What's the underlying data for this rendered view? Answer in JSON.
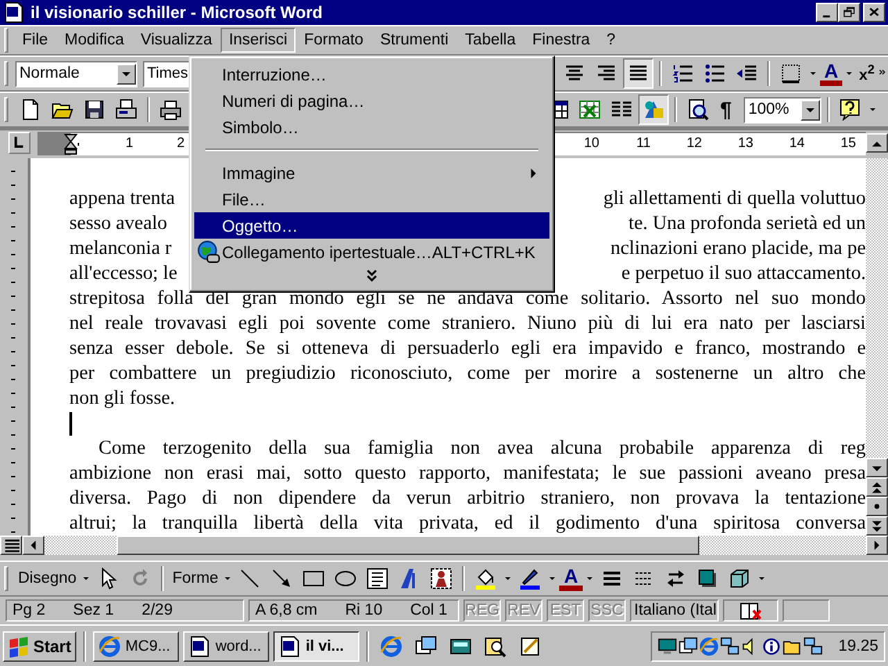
{
  "window": {
    "title": "il visionario schiller - Microsoft Word"
  },
  "menu_bar": [
    {
      "label": "File",
      "selected": false
    },
    {
      "label": "Modifica",
      "selected": false
    },
    {
      "label": "Visualizza",
      "selected": false
    },
    {
      "label": "Inserisci",
      "selected": true
    },
    {
      "label": "Formato",
      "selected": false
    },
    {
      "label": "Strumenti",
      "selected": false
    },
    {
      "label": "Tabella",
      "selected": false
    },
    {
      "label": "Finestra",
      "selected": false
    },
    {
      "label": "?",
      "selected": false
    }
  ],
  "formatting_toolbar": {
    "style": "Normale",
    "font": "Times",
    "alignment": [
      {
        "kind": "center",
        "selected": false
      },
      {
        "kind": "right",
        "selected": false
      },
      {
        "kind": "justify",
        "selected": true
      }
    ],
    "font_color": "A",
    "superscript": "x$^{2}$"
  },
  "standard_toolbar": {
    "drawing_toggle": {
      "on": true
    },
    "show_marks": "¶",
    "zoom": "100%"
  },
  "ruler": {
    "left_numbers": [
      "1",
      "2"
    ],
    "right_numbers": [
      "10",
      "11",
      "12",
      "13",
      "14",
      "15"
    ]
  },
  "insert_menu": [
    {
      "kind": "item",
      "label": "Interruzione…",
      "selected": false
    },
    {
      "kind": "item",
      "label": "Numeri di pagina…",
      "selected": false
    },
    {
      "kind": "item",
      "label": "Simbolo…",
      "selected": false
    },
    {
      "kind": "separator"
    },
    {
      "kind": "submenu",
      "label": "Immagine",
      "selected": false
    },
    {
      "kind": "item",
      "label": "File…",
      "selected": false
    },
    {
      "kind": "item",
      "label": "Oggetto…",
      "selected": true
    },
    {
      "kind": "link",
      "label": "Collegamento ipertestuale…",
      "shortcut": "ALT+CTRL+K",
      "selected": false
    },
    {
      "kind": "expand"
    }
  ],
  "document": {
    "lines": [
      {
        "kind": "split",
        "left": "appena trenta",
        "right": "gli allettamenti di quella voluttuo"
      },
      {
        "kind": "split",
        "left": "sesso avealo",
        "right": "te. Una profonda serietà ed un"
      },
      {
        "kind": "split",
        "left": "melanconia r",
        "right": "nclinazioni erano placide, ma pe"
      },
      {
        "kind": "split",
        "left": "all'eccesso; le",
        "right": "e perpetuo il suo attaccamento."
      },
      {
        "kind": "full",
        "text": "strepitosa folla del gran mondo egli se ne andava come solitario. Assorto nel suo mondo"
      },
      {
        "kind": "full",
        "text": "nel reale trovavasi egli poi sovente come straniero. Niuno più di lui era nato per lasciarsi"
      },
      {
        "kind": "full",
        "text": "senza esser debole. Se si otteneva di persuaderlo egli era impavido e franco, mostrando e"
      },
      {
        "kind": "full",
        "text": "per combattere un pregiudizio riconosciuto, come per morire a sostenerne un altro che"
      },
      {
        "kind": "last",
        "text": "non gli fosse."
      },
      {
        "kind": "cursor"
      },
      {
        "kind": "indent",
        "text": "Come terzogenito della sua famiglia non avea alcuna probabile apparenza di reg"
      },
      {
        "kind": "full",
        "text": "ambizione non erasi mai, sotto questo rapporto, manifestata; le sue passioni aveano presa"
      },
      {
        "kind": "full",
        "text": "diversa. Pago di non dipendere da verun arbitrio straniero, non provava la tentazione"
      },
      {
        "kind": "full",
        "text": "altrui; la tranquilla libertà della vita privata, ed il godimento d'una spiritosa conversa"
      }
    ]
  },
  "drawing_toolbar": {
    "draw": "Disegno",
    "shapes": "Forme",
    "font_color": "A"
  },
  "status_bar": {
    "page": "Pg 2",
    "section": "Sez 1",
    "pages": "2/29",
    "position": "A 6,8 cm",
    "line": "Ri 10",
    "column": "Col 1",
    "modes": [
      {
        "label": "REG",
        "on": false
      },
      {
        "label": "REV",
        "on": false
      },
      {
        "label": "EST",
        "on": false
      },
      {
        "label": "SSC",
        "on": false
      }
    ],
    "language": "Italiano (Ital"
  },
  "taskbar": {
    "start": "Start",
    "tasks": [
      {
        "label": "MC9...",
        "kind": "web",
        "selected": false
      },
      {
        "label": "word...",
        "kind": "doc",
        "selected": false
      },
      {
        "label": "il vi...",
        "kind": "doc",
        "selected": true
      }
    ],
    "clock": "19.25"
  }
}
